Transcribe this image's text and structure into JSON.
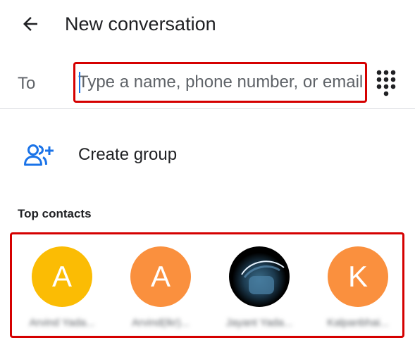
{
  "header": {
    "title": "New conversation",
    "back_icon": "arrow-back-icon"
  },
  "recipient": {
    "label": "To",
    "placeholder": "Type a name, phone number, or email",
    "value": "",
    "dialpad_icon": "dialpad-icon"
  },
  "create_group": {
    "label": "Create group",
    "icon": "group-add-icon",
    "icon_color": "#1a73e8"
  },
  "top_contacts": {
    "heading": "Top contacts",
    "contacts": [
      {
        "initial": "A",
        "name": "Arvind Yada...",
        "color": "#fbbc04"
      },
      {
        "initial": "A",
        "name": "Arvind(Ikr)...",
        "color": "#fa903e"
      },
      {
        "initial": "",
        "name": "Jayant Yada...",
        "color": "#000000"
      },
      {
        "initial": "K",
        "name": "Kalpanbhai...",
        "color": "#fa903e"
      }
    ]
  },
  "colors": {
    "highlight_border": "#d50000",
    "text_primary": "#202124",
    "text_secondary": "#5f6368",
    "accent": "#1a73e8"
  }
}
